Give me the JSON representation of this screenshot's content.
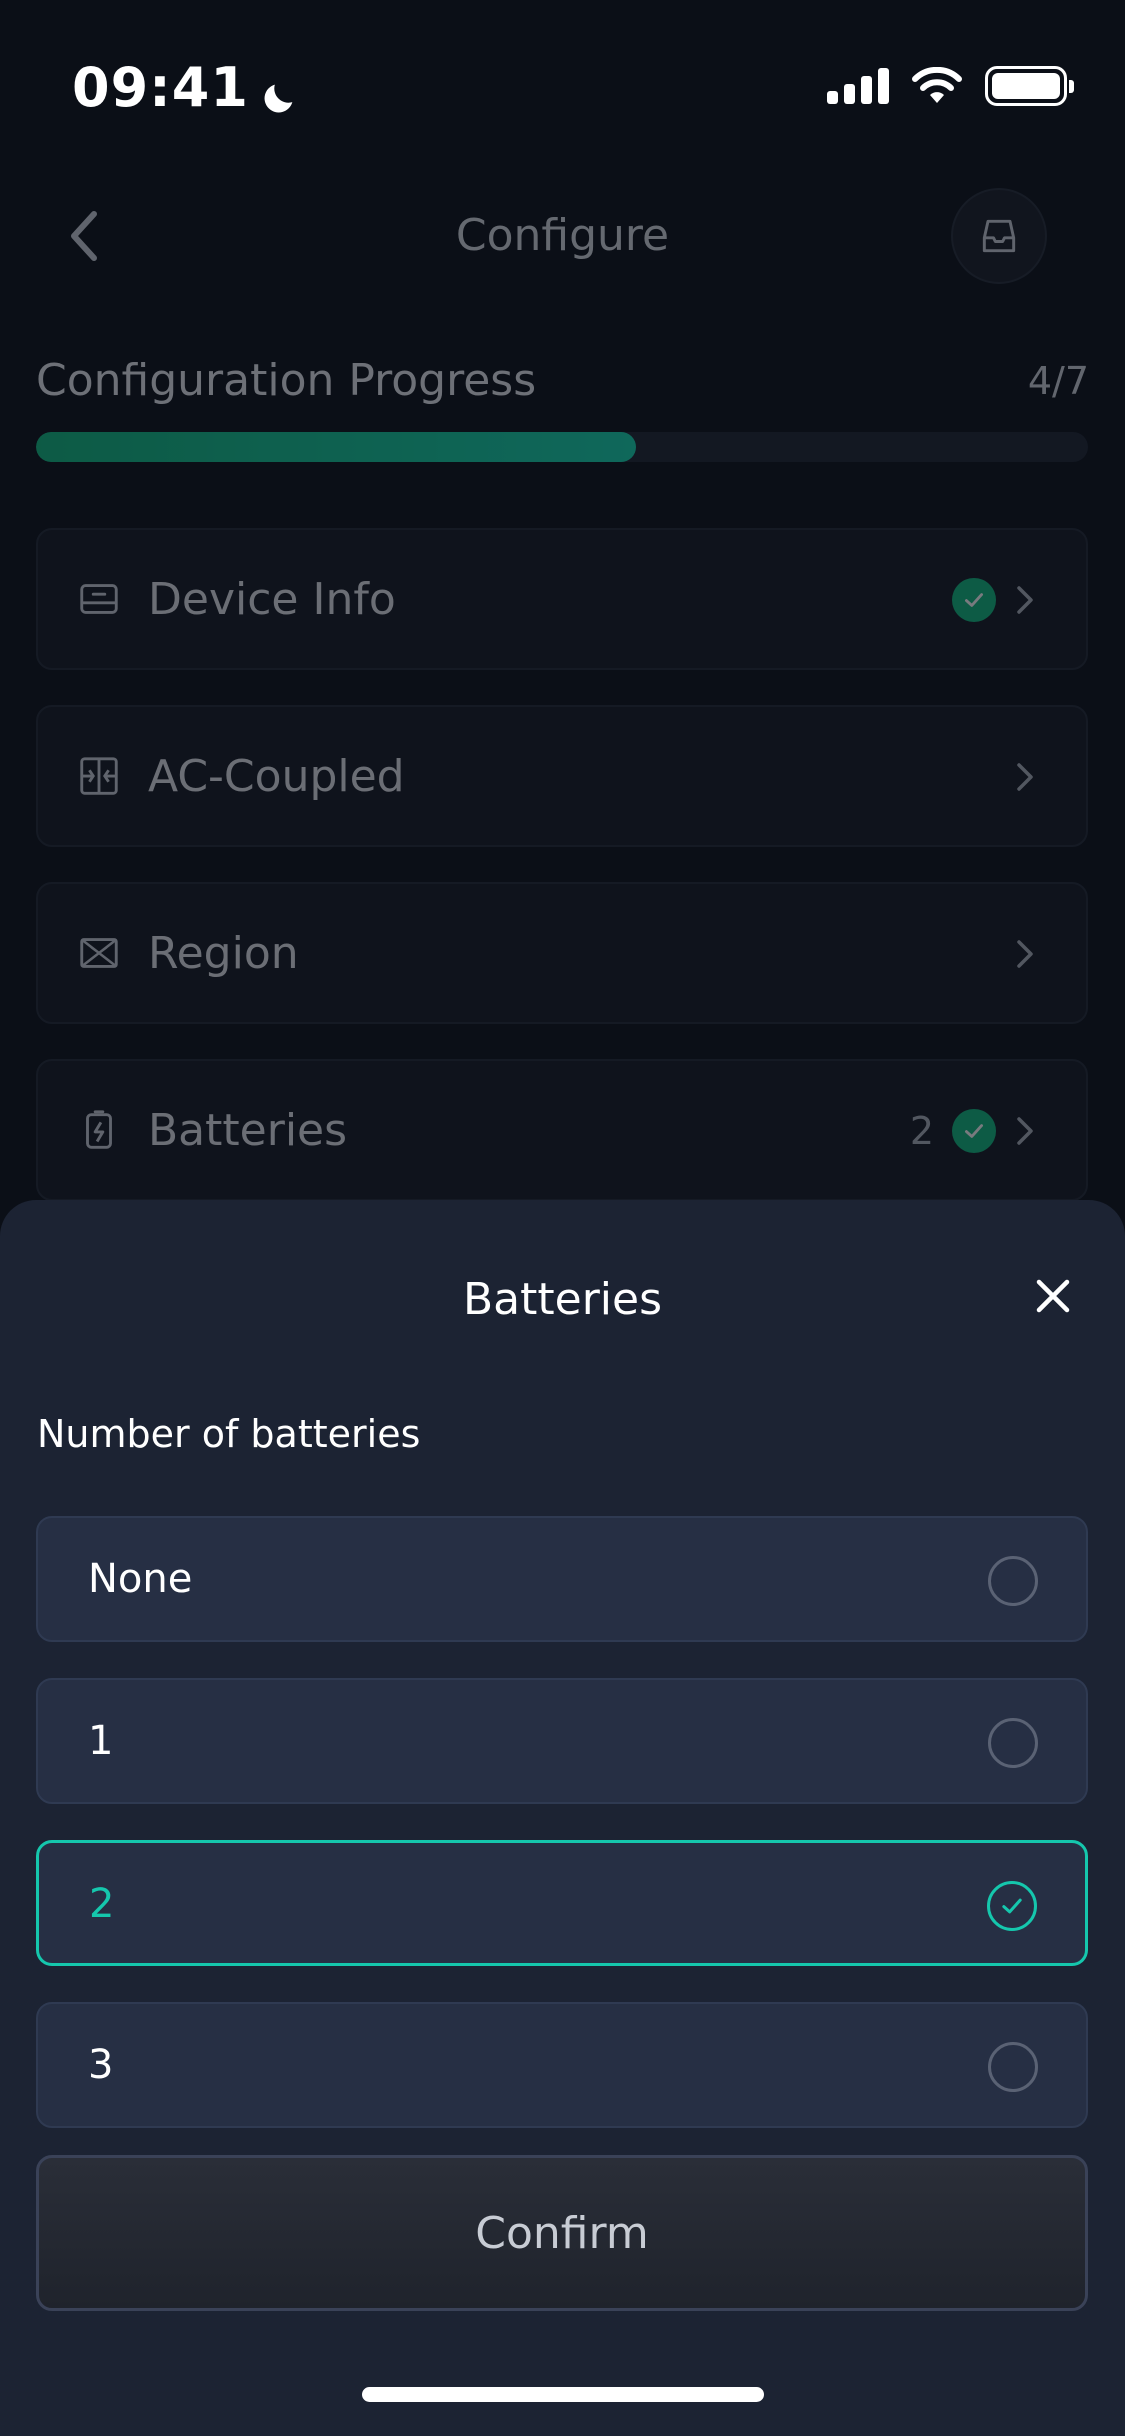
{
  "status_bar": {
    "time": "09:41"
  },
  "header": {
    "title": "Configure"
  },
  "progress": {
    "title": "Configuration Progress",
    "count": "4/7",
    "value": 0.57
  },
  "steps": [
    {
      "label": "Device Info",
      "icon": "device-info-icon",
      "count": "",
      "completed": true
    },
    {
      "label": "AC-Coupled",
      "icon": "ac-coupled-icon",
      "count": "",
      "completed": false
    },
    {
      "label": "Region",
      "icon": "region-icon",
      "count": "",
      "completed": false
    },
    {
      "label": "Batteries",
      "icon": "battery-icon",
      "count": "2",
      "completed": true
    }
  ],
  "sheet": {
    "title": "Batteries",
    "label": "Number of batteries",
    "options": [
      {
        "label": "None",
        "selected": false
      },
      {
        "label": "1",
        "selected": false
      },
      {
        "label": "2",
        "selected": true
      },
      {
        "label": "3",
        "selected": false
      }
    ],
    "confirm_label": "Confirm"
  },
  "colors": {
    "accent": "#15c7ad",
    "success": "#10b981",
    "sheet_bg": "#1c2333",
    "page_bg": "#0b0f17"
  }
}
